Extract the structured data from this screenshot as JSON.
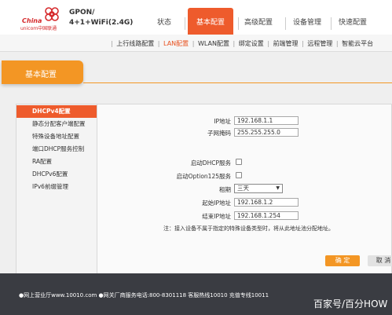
{
  "brand": {
    "china": "China",
    "unicom": "unicom中国联通",
    "product_line1": "GPON/",
    "product_line2": "4+1+WiFi(2.4G)"
  },
  "nav": {
    "tabs": [
      {
        "label": "状态"
      },
      {
        "label": "基本配置",
        "active": true
      },
      {
        "label": "高级配置"
      },
      {
        "label": "设备管理"
      },
      {
        "label": "快速配置"
      }
    ]
  },
  "subnav": {
    "items": [
      {
        "label": "上行线路配置"
      },
      {
        "label": "LAN配置",
        "active": true
      },
      {
        "label": "WLAN配置"
      },
      {
        "label": "绑定设置"
      },
      {
        "label": "前端管理"
      },
      {
        "label": "远程管理"
      },
      {
        "label": "智能云平台"
      }
    ]
  },
  "section": {
    "title": "基本配置"
  },
  "sidebar": {
    "items": [
      {
        "label": "DHCPv4配置",
        "active": true
      },
      {
        "label": "静态分配客户端配置"
      },
      {
        "label": "特殊设备地址配置"
      },
      {
        "label": "端口DHCP服务控制"
      },
      {
        "label": "RA配置"
      },
      {
        "label": "DHCPv6配置"
      },
      {
        "label": "IPv6前缀管理"
      }
    ]
  },
  "form": {
    "ip_label": "IP地址",
    "ip_value": "192.168.1.1",
    "mask_label": "子网掩码",
    "mask_value": "255.255.255.0",
    "dhcp_label": "启动DHCP服务",
    "opt125_label": "启动Option125服务",
    "lease_label": "租期",
    "lease_value": "三天",
    "start_label": "起始IP地址",
    "start_value": "192.168.1.2",
    "end_label": "结束IP地址",
    "end_value": "192.168.1.254",
    "note": "注：接入设备不属于指定的特殊设备类型时，将从此地址池分配地址。"
  },
  "buttons": {
    "ok": "确 定",
    "cancel": "取 消"
  },
  "footer": {
    "text": "●网上营业厅www.10010.com ●网关厂商服务电话:800-8301118 客服热线10010 充值专线10011",
    "watermark": "百家号/百分HOW"
  },
  "colors": {
    "accent": "#ee5b2c",
    "tab_orange": "#f39624",
    "footer": "#3a3c42"
  }
}
